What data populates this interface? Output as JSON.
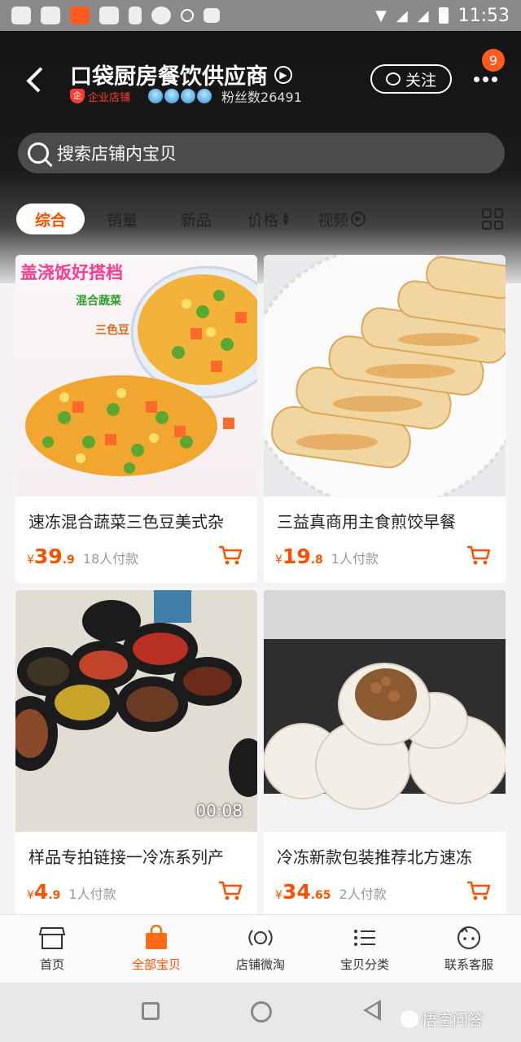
{
  "status_bar": {
    "time": "11:53",
    "icons": [
      "gallery-app-icon",
      "weibo-icon",
      "orange-app-icon",
      "smile-app-icon",
      "sim-card-icon",
      "browser-icon",
      "search-icon",
      "image-icon"
    ]
  },
  "header": {
    "store_name": "口袋厨房餐饮供应商",
    "enterprise_label": "企业店铺",
    "fans_label": "粉丝数26491",
    "follow_label": "关注",
    "notification_count": "9",
    "search_placeholder": "搜索店铺内宝贝"
  },
  "sort_tabs": [
    {
      "label": "综合",
      "active": true
    },
    {
      "label": "销量"
    },
    {
      "label": "新品"
    },
    {
      "label": "价格"
    },
    {
      "label": "视频"
    }
  ],
  "products": [
    {
      "title": "速冻混合蔬菜三色豆美式杂",
      "price_symbol": "¥",
      "price_int": "39",
      "price_dec": ".9",
      "sold": "18人付款",
      "banner": "盖浇饭好搭档",
      "tag1": "混合蔬菜",
      "tag2": "三色豆"
    },
    {
      "title": "三益真商用主食煎饺早餐",
      "price_symbol": "¥",
      "price_int": "19",
      "price_dec": ".8",
      "sold": "1人付款"
    },
    {
      "title": "样品专拍链接一冷冻系列产",
      "price_symbol": "¥",
      "price_int": "4",
      "price_dec": ".9",
      "sold": "1人付款",
      "video_time": "00:08"
    },
    {
      "title": "冷冻新款包装推荐北方速冻",
      "price_symbol": "¥",
      "price_int": "34",
      "price_dec": ".65",
      "sold": "2人付款"
    }
  ],
  "bottom_nav": [
    {
      "label": "首页"
    },
    {
      "label": "全部宝贝",
      "active": true
    },
    {
      "label": "店铺微淘"
    },
    {
      "label": "宝贝分类"
    },
    {
      "label": "联系客服"
    }
  ],
  "watermark": "悟空问答",
  "colors": {
    "accent": "#ff5000",
    "header_bg": "#141414"
  }
}
